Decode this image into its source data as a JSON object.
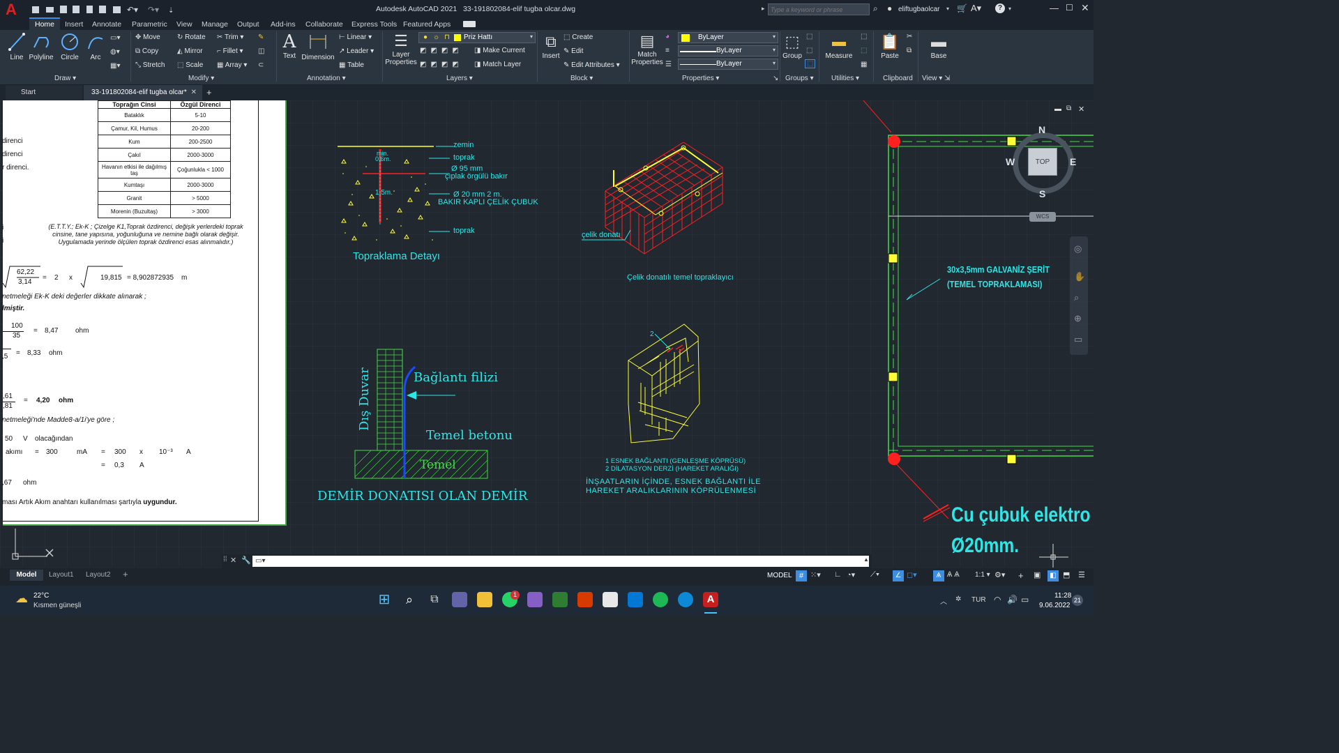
{
  "titlebar": {
    "app_title": "Autodesk AutoCAD 2021",
    "file_name": "33-191802084-elif tugba olcar.dwg",
    "search_placeholder": "Type a keyword or phrase",
    "user_name": "eliftugbaolcar"
  },
  "ribbon_tabs": [
    "Home",
    "Insert",
    "Annotate",
    "Parametric",
    "View",
    "Manage",
    "Output",
    "Add-ins",
    "Collaborate",
    "Express Tools",
    "Featured Apps"
  ],
  "draw": {
    "panel": "Draw",
    "line": "Line",
    "polyline": "Polyline",
    "circle": "Circle",
    "arc": "Arc"
  },
  "modify": {
    "panel": "Modify",
    "move": "Move",
    "rotate": "Rotate",
    "trim": "Trim",
    "copy": "Copy",
    "mirror": "Mirror",
    "fillet": "Fillet",
    "stretch": "Stretch",
    "scale": "Scale",
    "array": "Array"
  },
  "annotation": {
    "panel": "Annotation",
    "text": "Text",
    "dimension": "Dimension",
    "linear": "Linear",
    "leader": "Leader",
    "table": "Table"
  },
  "layers": {
    "panel": "Layers",
    "layer_properties": "Layer Properties",
    "current_layer": "Priz Hattı",
    "make_current": "Make Current",
    "match_layer": "Match Layer"
  },
  "block": {
    "panel": "Block",
    "insert": "Insert",
    "create": "Create",
    "edit": "Edit",
    "edit_attributes": "Edit Attributes"
  },
  "properties": {
    "panel": "Properties",
    "match": "Match Properties",
    "color": "ByLayer",
    "linetype": "ByLayer",
    "lineweight": "ByLayer"
  },
  "groups": {
    "panel": "Groups",
    "group": "Group"
  },
  "utilities": {
    "panel": "Utilities",
    "measure": "Measure"
  },
  "clipboard": {
    "panel": "Clipboard",
    "paste": "Paste"
  },
  "view": {
    "panel": "View",
    "base": "Base"
  },
  "doc_tabs": {
    "start": "Start",
    "active": "33-191802084-elif tugba olcar*"
  },
  "sheet": {
    "table_header": [
      "Toprağın Cinsi",
      "Özgül Direnci"
    ],
    "table_rows": [
      [
        "Bataklık",
        "5-10"
      ],
      [
        "Çamur, Kil, Humus",
        "20-200"
      ],
      [
        "Kum",
        "200-2500"
      ],
      [
        "Çakıl",
        "2000-3000"
      ],
      [
        "Havanın etkisi ile dağılmış taş",
        "Çoğunlukla < 1000"
      ],
      [
        "Kumtaşı",
        "2000-3000"
      ],
      [
        "Granit",
        "> 5000"
      ],
      [
        "Morenin (Buzultaş)",
        "> 3000"
      ]
    ],
    "left_frag_1": "direnci",
    "left_frag_2": "direnci",
    "left_frag_3": "r direnci.",
    "left_frag_4": "i",
    "left_frag_5": "i",
    "note": "(E.T.T.Y.; Ek-K ; Çizelge K1,Toprak özdirenci, değişik yerlerdeki toprak cinsine, tane yapısına, yoğunluğuna ve nemine bağlı olarak değişir. Uygulamada yerinde ölçülen toprak özdirenci esas alınmalıdır.)",
    "f1_num": "62,22",
    "f1_den": "3,14",
    "f1_eq": "=",
    "f1_two": "2",
    "f1_x": "x",
    "f1_root": "19,815",
    "f1_result": "= 8,902872935",
    "f1_unit": "m",
    "line_ekk": "netmeleği Ek-K deki değerler dikkate alınarak ;",
    "line_bold": "lmiştir.",
    "f2_num": "100",
    "f2_den": "35",
    "f2_eq": "=",
    "f2_val": "8,47",
    "f2_unit": "ohm",
    "f3_den": ",5",
    "f3_eq": "=",
    "f3_val": "8,33",
    "f3_unit": "ohm",
    "f4_num": ",61",
    "f4_den": ",81",
    "f4_eq": "=",
    "f4_val": "4,20",
    "f4_unit": "ohm",
    "madde": "netmeleği'nde Madde8-a/1i'ye göre ;",
    "v_val": "50",
    "v_unit": "V",
    "v_text": "olacağından",
    "akim_label": "akımı",
    "akim_eq": "=",
    "akim_val": "300",
    "akim_unit": "mA",
    "akim_eq2": "=",
    "akim_300": "300",
    "akim_x": "x",
    "akim_pow": "10⁻³",
    "akim_A": "A",
    "a_eq": "=",
    "a_val": "0,3",
    "a_unit": "A",
    "r_val": ",67",
    "r_unit": "ohm",
    "final_pre": "ması Artık Akım anahtarı kullanılması şartıyla ",
    "final_bold": "uygundur."
  },
  "drawing": {
    "zemin": "zemin",
    "min": "min.",
    "d06": "0,6m.",
    "toprak1": "toprak",
    "d95": "Ø 95 mm",
    "ciplak": "çıplak örgülü bakır",
    "d15": "1,5m.",
    "d20": "Ø 20 mm 2 m.",
    "bakir": "BAKIR KAPLI ÇELİK ÇUBUK",
    "toprak2": "toprak",
    "topraklama_title": "Topraklama Detayı",
    "celik_donati": "çelik donatı",
    "celik_title": "Çelik donatılı temel topraklayıcı",
    "dis_duvar": "Dış Duvar",
    "baglanti": "Bağlantı filizi",
    "temel_betonu": "Temel betonu",
    "temel": "Temel",
    "demir_title": "DEMİR DONATISI OLAN DEMİR",
    "num2": "2",
    "legend1": "1   ESNEK BAĞLANTI (GENLEŞME KÖPRÜSÜ)",
    "legend2": "2   DİLATASYON DERZİ (HAREKET ARALIĞI)",
    "insaat1": "İNŞAATLARIN İÇİNDE, ESNEK BAĞLANTI İLE",
    "insaat2": "HAREKET ARALIKLARININ KÖPRÜLENMESİ",
    "galvaniz1": "30x3,5mm GALVANİZ ŞERİT",
    "galvaniz2": "(TEMEL TOPRAKLAMASI)",
    "cu1": "Cu çubuk elektro",
    "cu2": "Ø20mm."
  },
  "viewcube": {
    "n": "N",
    "s": "S",
    "e": "E",
    "w": "W",
    "top": "TOP",
    "wcs": "WCS"
  },
  "command": {
    "placeholder": ""
  },
  "layout_tabs": [
    "Model",
    "Layout1",
    "Layout2"
  ],
  "status": {
    "model": "MODEL",
    "scale": "1:1"
  },
  "weather": {
    "temp": "22°C",
    "desc": "Kısmen güneşli"
  },
  "system": {
    "lang": "TUR",
    "time": "11:28",
    "date": "9.06.2022",
    "notif": "21",
    "whatsapp_badge": "1"
  },
  "colors": {
    "accent_red": "#c5201f",
    "cad_cyan": "#2ee6e6",
    "cad_yellow": "#ffff33",
    "cad_red": "#ff2020",
    "cad_green": "#44dd44"
  }
}
